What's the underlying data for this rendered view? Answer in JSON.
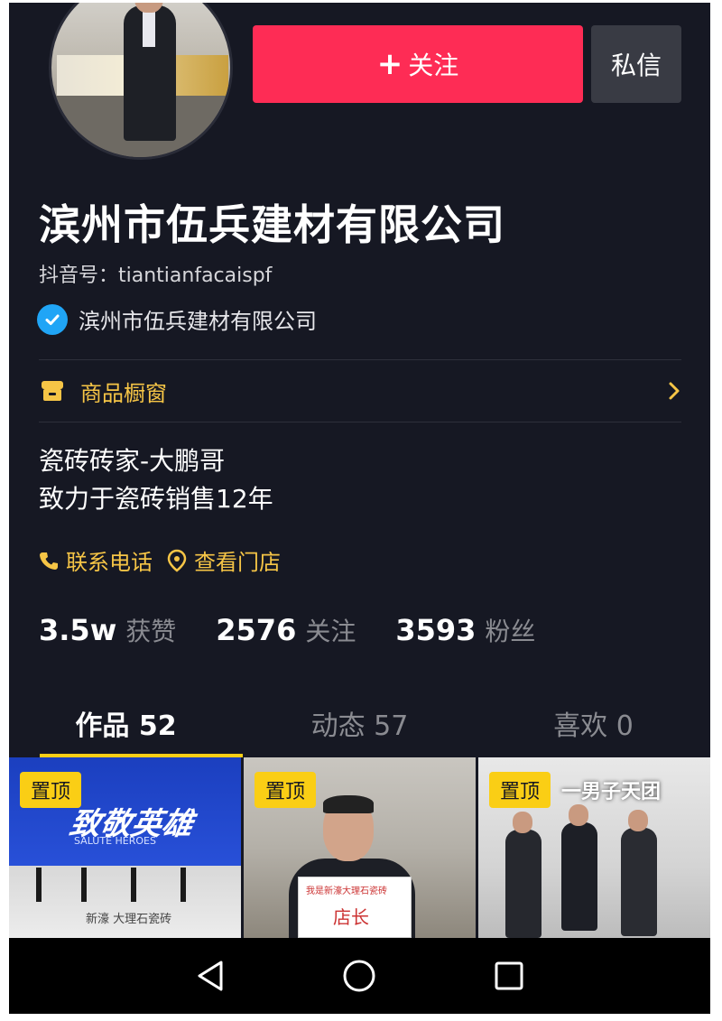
{
  "header": {
    "follow_label": "关注",
    "message_label": "私信"
  },
  "profile": {
    "name": "滨州市伍兵建材有限公司",
    "douyin_id": "抖音号：tiantianfacaispf",
    "verified_name": "滨州市伍兵建材有限公司"
  },
  "showcase": {
    "label": "商品橱窗"
  },
  "bio": {
    "line1": "瓷砖砖家-大鹏哥",
    "line2": "致力于瓷砖销售12年"
  },
  "contacts": {
    "phone_label": "联系电话",
    "store_label": "查看门店"
  },
  "stats": {
    "likes_value": "3.5w",
    "likes_label": "获赞",
    "following_value": "2576",
    "following_label": "关注",
    "followers_value": "3593",
    "followers_label": "粉丝"
  },
  "tabs": [
    {
      "label": "作品 52"
    },
    {
      "label": "动态 57"
    },
    {
      "label": "喜欢 0"
    }
  ],
  "videos": [
    {
      "pin_label": "置顶",
      "overlay_text": "致敬英雄",
      "sub_text": "SALUTE HEROES",
      "store_text": "新濠 大理石瓷砖"
    },
    {
      "pin_label": "置顶",
      "sign_line1": "我是新濠大理石瓷砖",
      "sign_line2": "店长"
    },
    {
      "pin_label": "置顶",
      "overlay_text": "一男子天团"
    }
  ],
  "icons": {
    "verified": "verified-check-icon",
    "shop": "shop-icon",
    "chevron": "chevron-right-icon",
    "phone": "phone-icon",
    "location": "location-pin-icon",
    "back": "nav-back-icon",
    "home": "nav-home-icon",
    "recent": "nav-recent-icon"
  },
  "colors": {
    "background": "#161823",
    "follow_button": "#fe2c55",
    "message_button": "#393b44",
    "accent_yellow": "#f6c546",
    "verified_blue": "#20a5f6",
    "tab_indicator": "#face15"
  }
}
